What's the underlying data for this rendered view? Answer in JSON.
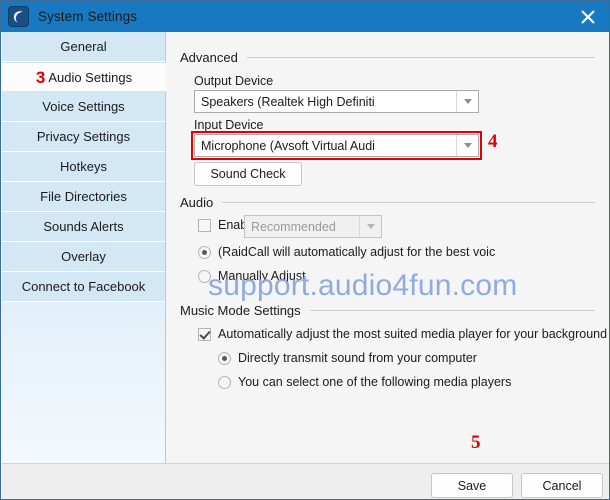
{
  "window": {
    "title": "System Settings",
    "logo_icon": "raidcall-logo-icon",
    "close_icon": "close-icon"
  },
  "sidebar": {
    "items": [
      {
        "label": "General",
        "selected": false,
        "badge": ""
      },
      {
        "label": "Audio Settings",
        "selected": true,
        "badge": "3"
      },
      {
        "label": "Voice Settings",
        "selected": false,
        "badge": ""
      },
      {
        "label": "Privacy Settings",
        "selected": false,
        "badge": ""
      },
      {
        "label": "Hotkeys",
        "selected": false,
        "badge": ""
      },
      {
        "label": "File Directories",
        "selected": false,
        "badge": ""
      },
      {
        "label": "Sounds Alerts",
        "selected": false,
        "badge": ""
      },
      {
        "label": "Overlay",
        "selected": false,
        "badge": ""
      },
      {
        "label": "Connect to Facebook",
        "selected": false,
        "badge": ""
      }
    ]
  },
  "main": {
    "advanced": {
      "section_title": "Advanced",
      "output_label": "Output Device",
      "output_value": "Speakers (Realtek High Definiti",
      "input_label": "Input Device",
      "input_value": "Microphone (Avsoft Virtual Audi",
      "input_marker": "4",
      "sound_check_label": "Sound Check"
    },
    "audio": {
      "section_title": "Audio",
      "enable_label": "Enable R",
      "enable_checked": false,
      "recommended_value": "Recommended",
      "auto_label": "(RaidCall will automatically adjust for the best voic",
      "auto_selected": true,
      "manual_label": "Manually Adjust",
      "manual_selected": false
    },
    "music": {
      "section_title": "Music Mode Settings",
      "auto_adjust_label": "Automatically adjust the most suited media player for your background",
      "auto_adjust_checked": true,
      "direct_label": "Directly transmit sound from your computer",
      "direct_selected": true,
      "select_player_label": "You can select one of the following media players",
      "select_player_selected": false
    },
    "watermark": "support.audio4fun.com"
  },
  "footer": {
    "save_label": "Save",
    "cancel_label": "Cancel",
    "save_marker": "5"
  },
  "colors": {
    "titlebar": "#1878c0",
    "accent_red": "#e00000",
    "sidebar": "#d4e7f4",
    "watermark": "#8fabdf"
  }
}
